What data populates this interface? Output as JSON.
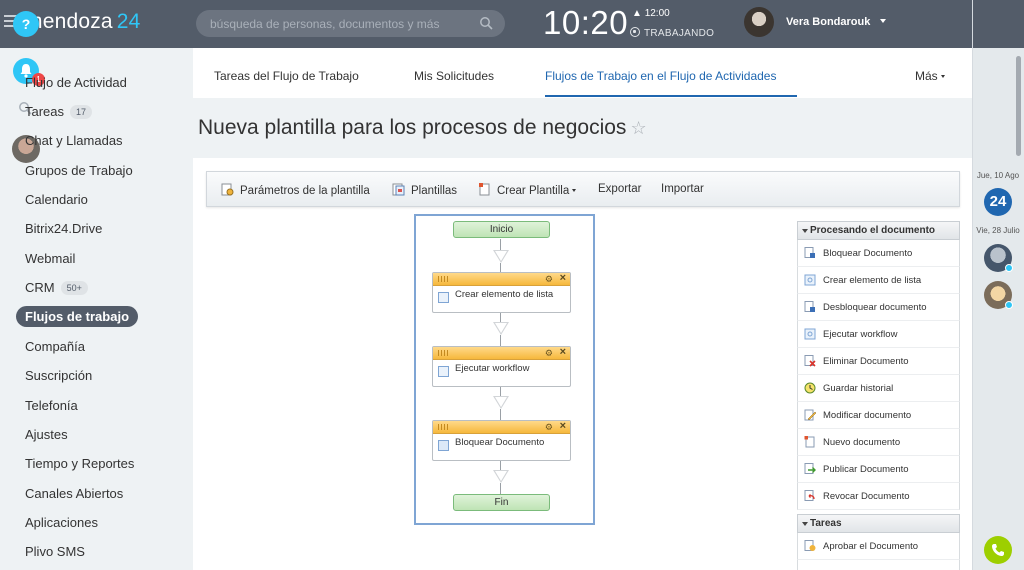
{
  "header": {
    "logo_name": "mendoza",
    "logo_number": "24",
    "search_placeholder": "búsqueda de personas, documentos y más",
    "clock": "10:20",
    "alarm": "12:00",
    "status": "TRABAJANDO",
    "user_name": "Vera Bondarouk"
  },
  "sidebar": {
    "items": [
      {
        "label": "Flujo de Actividad"
      },
      {
        "label": "Tareas",
        "count": "17"
      },
      {
        "label": "Chat y Llamadas"
      },
      {
        "label": "Grupos de Trabajo"
      },
      {
        "label": "Calendario"
      },
      {
        "label": "Bitrix24.Drive"
      },
      {
        "label": "Webmail"
      },
      {
        "label": "CRM",
        "count": "50+"
      },
      {
        "label": "Flujos de trabajo",
        "active": true
      },
      {
        "label": "Compañía"
      },
      {
        "label": "Suscripción"
      },
      {
        "label": "Telefonía"
      },
      {
        "label": "Ajustes"
      },
      {
        "label": "Tiempo y Reportes"
      },
      {
        "label": "Canales Abiertos"
      },
      {
        "label": "Aplicaciones"
      },
      {
        "label": "Plivo SMS"
      }
    ]
  },
  "tabs": [
    {
      "label": "Tareas del Flujo de Trabajo"
    },
    {
      "label": "Mis Solicitudes"
    },
    {
      "label": "Flujos de Trabajo en el Flujo de Actividades",
      "active": true
    },
    {
      "label": "Más"
    }
  ],
  "page_title": "Nueva plantilla para los procesos de negocios",
  "toolbar": {
    "params": "Parámetros de la plantilla",
    "templates": "Plantillas",
    "create": "Crear Plantilla",
    "export": "Exportar",
    "import": "Importar"
  },
  "workflow": {
    "start": "Inicio",
    "end": "Fin",
    "activities": [
      "Crear elemento de lista",
      "Ejecutar workflow",
      "Bloquear Documento"
    ]
  },
  "activity_panel": {
    "section1": "Procesando el documento",
    "items": [
      "Bloquear Documento",
      "Crear elemento de lista",
      "Desbloquear documento",
      "Ejecutar workflow",
      "Eliminar Documento",
      "Guardar historial",
      "Modificar documento",
      "Nuevo documento",
      "Publicar Documento",
      "Revocar Documento"
    ],
    "section2": "Tareas",
    "items2": [
      "Aprobar el Documento"
    ]
  },
  "rail": {
    "help": "?",
    "badge": "1",
    "date1": "Jue, 10 Ago",
    "b24": "24",
    "date2": "Vie, 28 Julio"
  },
  "colors": {
    "header_bg": "#535c69",
    "accent": "#2fc6f6",
    "link_blue": "#2067b0",
    "phone_green": "#9dcf00"
  }
}
